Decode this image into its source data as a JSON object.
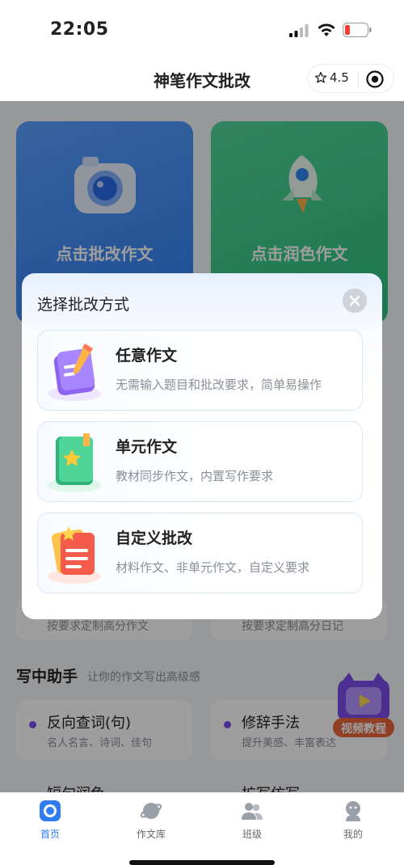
{
  "status_bar": {
    "time": "22:05"
  },
  "nav": {
    "title": "神笔作文批改",
    "rating": "4.5"
  },
  "background_page": {
    "cards": [
      {
        "title": "点击批改作文"
      },
      {
        "title": "点击润色作文"
      }
    ],
    "hints": [
      "按要求定制高分作文",
      "按要求定制高分日记"
    ],
    "section": {
      "title": "写中助手",
      "subtitle": "让你的作文写出高级感"
    },
    "tools": [
      {
        "title": "反向查词(句)",
        "subtitle": "名人名言、诗词、佳句"
      },
      {
        "title": "修辞手法",
        "subtitle": "提升美感、丰富表达"
      }
    ],
    "tools_cut": [
      "短句润色",
      "扩写仿写"
    ],
    "video_badge": "视频教程"
  },
  "dialog": {
    "title": "选择批改方式",
    "options": [
      {
        "name": "任意作文",
        "desc": "无需输入题目和批改要求，简单易操作",
        "icon": "purple-notebook-pencil-icon"
      },
      {
        "name": "单元作文",
        "desc": "教材同步作文，内置写作要求",
        "icon": "green-book-star-icon"
      },
      {
        "name": "自定义批改",
        "desc": "材料作文、非单元作文，自定义要求",
        "icon": "red-document-star-icon"
      }
    ]
  },
  "tabbar": {
    "items": [
      {
        "label": "首页",
        "active": true
      },
      {
        "label": "作文库",
        "active": false
      },
      {
        "label": "班级",
        "active": false
      },
      {
        "label": "我的",
        "active": false
      }
    ]
  },
  "colors": {
    "accent": "#2f7df0",
    "overlay": "rgba(0,0,0,0.38)",
    "card_blue": "#3d88f5",
    "card_green": "#34c985"
  }
}
